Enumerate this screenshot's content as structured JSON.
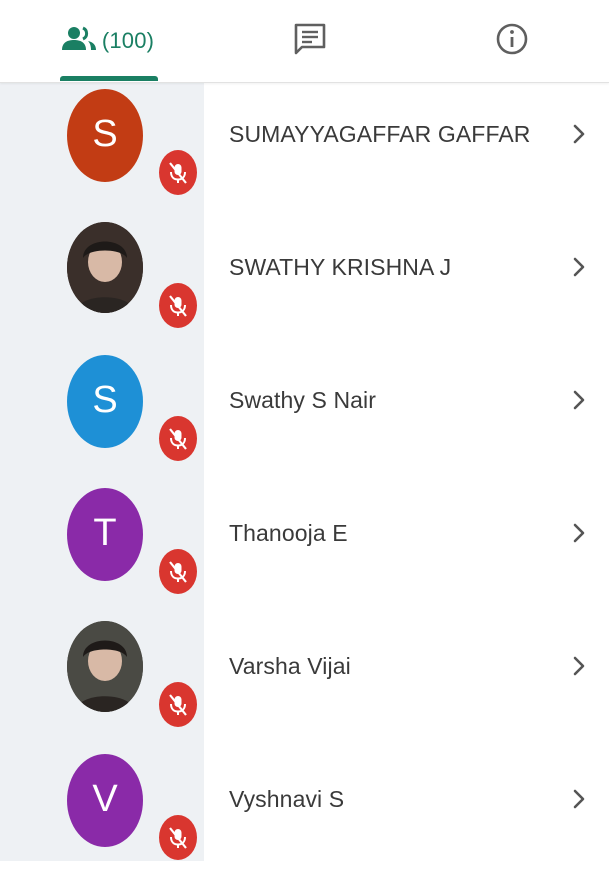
{
  "tabs": {
    "people": {
      "icon": "people-icon",
      "count_label": "(100)"
    },
    "chat": {
      "icon": "chat-icon"
    },
    "info": {
      "icon": "info-icon"
    }
  },
  "colors": {
    "accent": "#1a7f63",
    "mute_badge": "#d9362f",
    "rail": "#eef1f4"
  },
  "participants": [
    {
      "name": "SUMAYYAGAFFAR GAFFAR",
      "avatar_letter": "S",
      "avatar_color": "#c23c14",
      "muted": true
    },
    {
      "name": "SWATHY KRISHNA J",
      "avatar_letter": "",
      "avatar_color": "#3a2f2a",
      "muted": true
    },
    {
      "name": "Swathy S Nair",
      "avatar_letter": "S",
      "avatar_color": "#1e90d6",
      "muted": true
    },
    {
      "name": "Thanooja E",
      "avatar_letter": "T",
      "avatar_color": "#8a2aa8",
      "muted": true
    },
    {
      "name": "Varsha Vijai",
      "avatar_letter": "",
      "avatar_color": "#4a4a44",
      "muted": true
    },
    {
      "name": "Vyshnavi S",
      "avatar_letter": "V",
      "avatar_color": "#8a2aa8",
      "muted": true
    }
  ]
}
